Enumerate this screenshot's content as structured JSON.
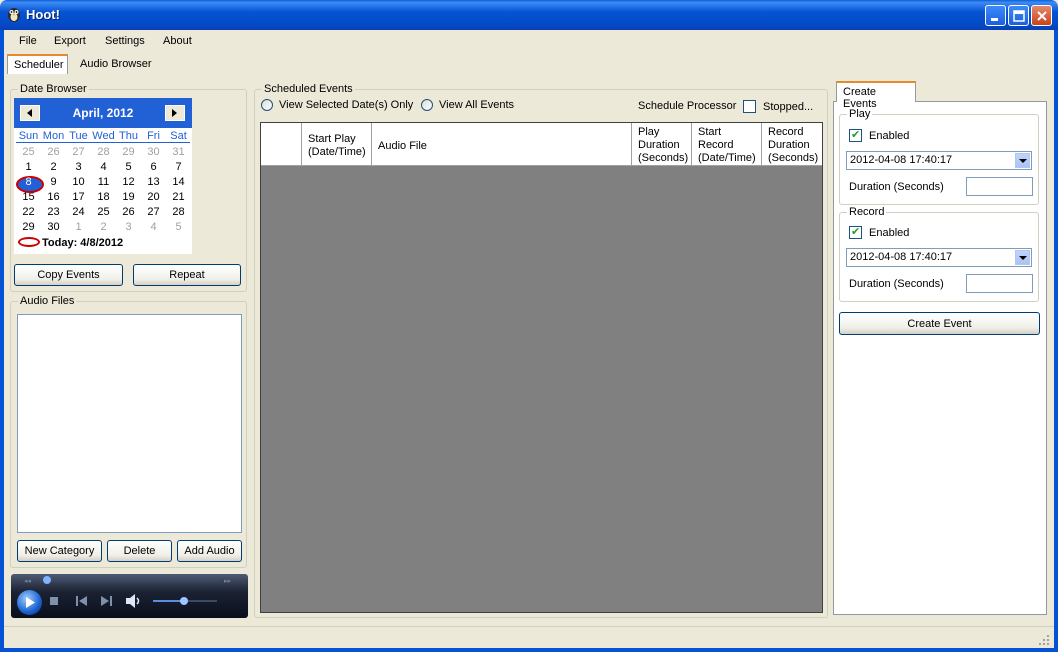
{
  "window": {
    "title": "Hoot!"
  },
  "menu": [
    "File",
    "Export",
    "Settings",
    "About"
  ],
  "tabs": [
    "Scheduler",
    "Audio Browser"
  ],
  "date_browser": {
    "label": "Date Browser",
    "month_title": "April, 2012",
    "day_headers": [
      "Sun",
      "Mon",
      "Tue",
      "Wed",
      "Thu",
      "Fri",
      "Sat"
    ],
    "weeks": [
      [
        "25",
        "26",
        "27",
        "28",
        "29",
        "30",
        "31"
      ],
      [
        "1",
        "2",
        "3",
        "4",
        "5",
        "6",
        "7"
      ],
      [
        "8",
        "9",
        "10",
        "11",
        "12",
        "13",
        "14"
      ],
      [
        "15",
        "16",
        "17",
        "18",
        "19",
        "20",
        "21"
      ],
      [
        "22",
        "23",
        "24",
        "25",
        "26",
        "27",
        "28"
      ],
      [
        "29",
        "30",
        "1",
        "2",
        "3",
        "4",
        "5"
      ]
    ],
    "selected_day": "8",
    "today_text": "Today: 4/8/2012",
    "copy_events": "Copy Events",
    "repeat": "Repeat"
  },
  "audio_files": {
    "label": "Audio Files",
    "new_category": "New Category",
    "delete": "Delete",
    "add_audio": "Add Audio"
  },
  "scheduled_events": {
    "label": "Scheduled Events",
    "view_selected": "View Selected Date(s) Only",
    "view_all": "View All Events",
    "schedule_processor": "Schedule Processor",
    "stopped": "Stopped...",
    "columns": [
      "Start Play\n(Date/Time)",
      "Audio File",
      "Play\nDuration\n(Seconds)",
      "Start\nRecord\n(Date/Time)",
      "Record\nDuration\n(Seconds)"
    ]
  },
  "create_events": {
    "tab": "Create Events",
    "play": {
      "label": "Play",
      "enabled_label": "Enabled",
      "enabled": true,
      "datetime": "2012-04-08 17:40:17",
      "duration_label": "Duration (Seconds)",
      "duration_value": ""
    },
    "record": {
      "label": "Record",
      "enabled_label": "Enabled",
      "enabled": true,
      "datetime": "2012-04-08 17:40:17",
      "duration_label": "Duration (Seconds)",
      "duration_value": ""
    },
    "create_button": "Create Event"
  },
  "colors": {
    "titlebar": "#0553d4",
    "calendar_header": "#2260d6",
    "grid_bg": "#808080",
    "today_circle": "#cc0000"
  }
}
